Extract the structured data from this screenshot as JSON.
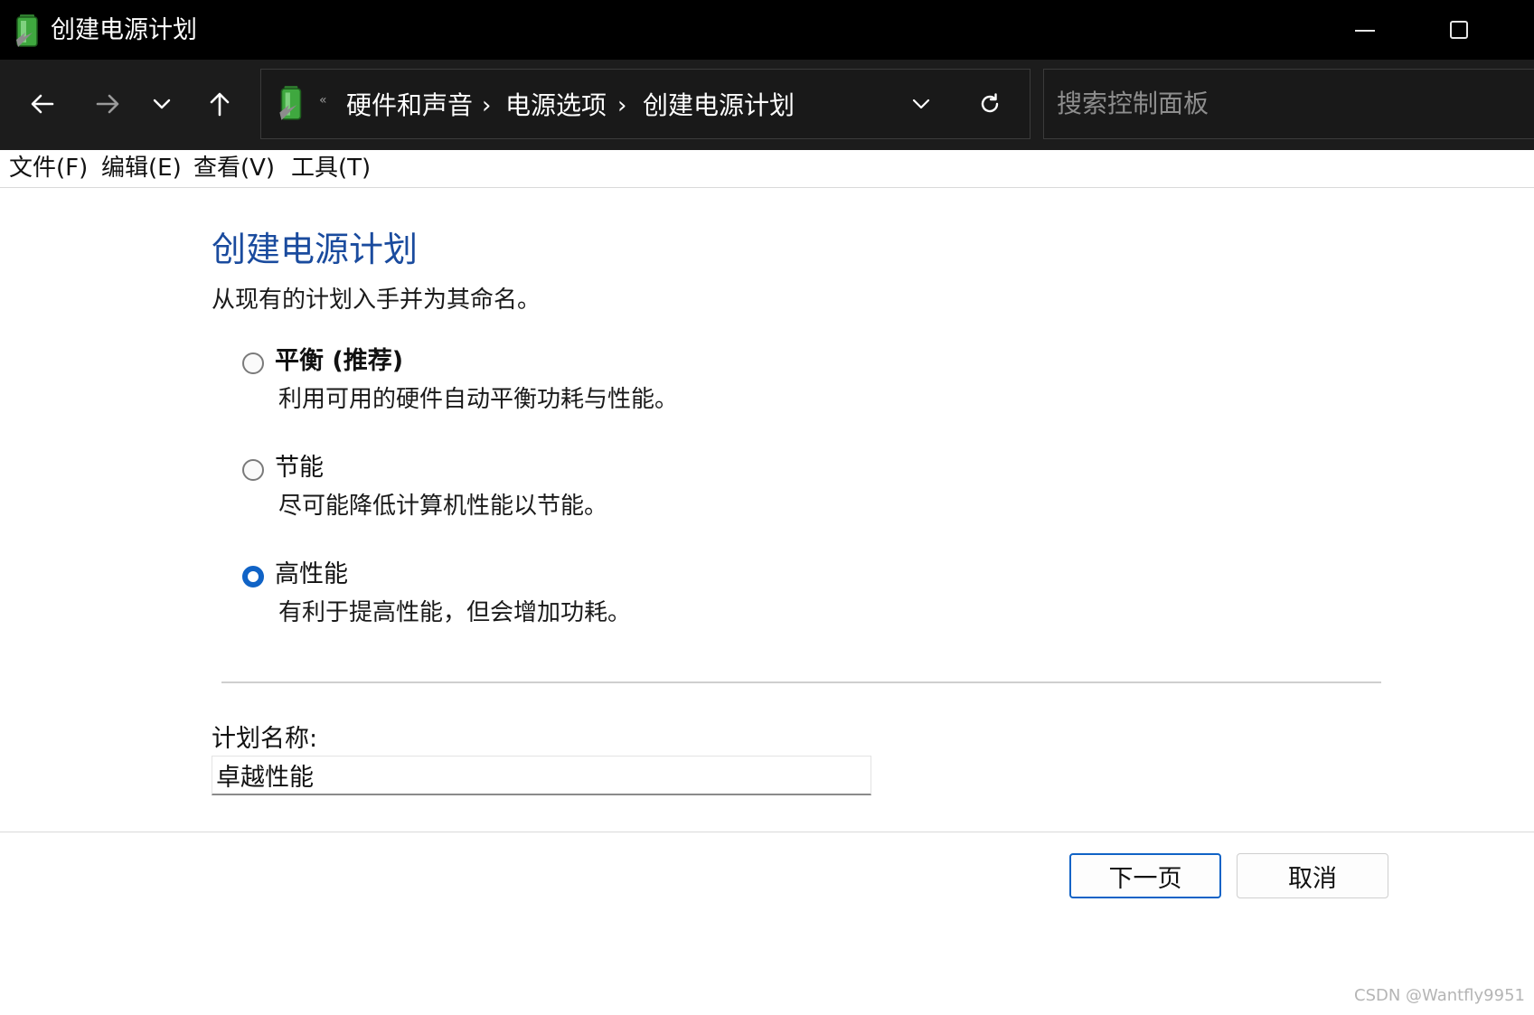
{
  "window": {
    "title": "创建电源计划",
    "icon": "battery-power-icon"
  },
  "navigation": {
    "back_icon": "arrow-left-icon",
    "forward_icon": "arrow-right-icon",
    "recent_icon": "chevron-down-icon",
    "up_icon": "arrow-up-icon",
    "breadcrumb": [
      "硬件和声音",
      "电源选项",
      "创建电源计划"
    ],
    "search_placeholder": "搜索控制面板"
  },
  "menu": {
    "items": [
      "文件(F)",
      "编辑(E)",
      "查看(V)",
      "工具(T)"
    ]
  },
  "content": {
    "heading": "创建电源计划",
    "subtitle": "从现有的计划入手并为其命名。",
    "options": [
      {
        "label": "平衡 (推荐)",
        "description": "利用可用的硬件自动平衡功耗与性能。",
        "selected": false
      },
      {
        "label": "节能",
        "description": "尽可能降低计算机性能以节能。",
        "selected": false
      },
      {
        "label": "高性能",
        "description": "有利于提高性能，但会增加功耗。",
        "selected": true
      }
    ],
    "plan_name_label": "计划名称:",
    "plan_name_value": "卓越性能"
  },
  "buttons": {
    "next": "下一页",
    "cancel": "取消"
  },
  "watermark": "CSDN @Wantfly9951",
  "colors": {
    "accent": "#1063c6",
    "heading": "#1a4b9e"
  }
}
